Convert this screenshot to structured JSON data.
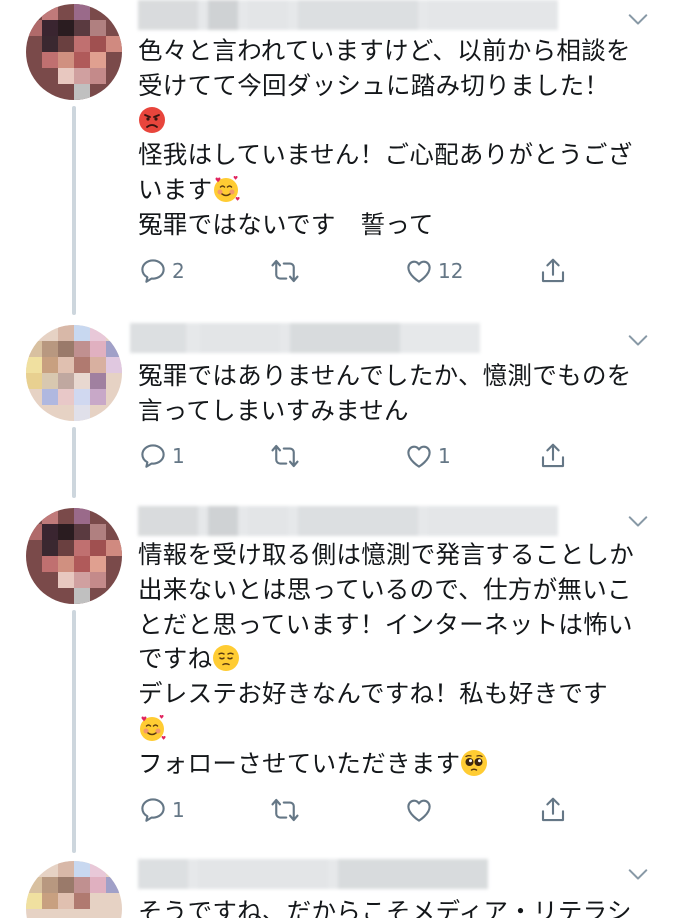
{
  "tweets": [
    {
      "id": "t1",
      "text": "色々と言われていますけど、以前から相談を\n受けてて今回ダッシュに踏み切りました！\n{angry}\n怪我はしていません！ご心配ありがとうござ\nいます{hearts}\n冤罪ではないです　誓って",
      "reply_count": "2",
      "retweet_count": "",
      "like_count": "12"
    },
    {
      "id": "t2",
      "text": "冤罪ではありませんでしたか、憶測でものを\n言ってしまいすみません",
      "reply_count": "1",
      "retweet_count": "",
      "like_count": "1"
    },
    {
      "id": "t3",
      "text": "情報を受け取る側は憶測で発言することしか\n出来ないとは思っているので、仕方が無いこ\nとだと思っています！インターネットは怖い\nですね{pensive}\nデレステお好きなんですね！私も好きです\n{hearts}\nフォローさせていただきます{pleading}",
      "reply_count": "1",
      "retweet_count": "",
      "like_count": ""
    },
    {
      "id": "t4",
      "text": "そうですね、だからこそメディア・リテラシ"
    }
  ],
  "icons": {
    "reply": "reply-icon",
    "retweet": "retweet-icon",
    "like": "heart-icon",
    "share": "share-icon",
    "menu": "chevron-down-icon"
  },
  "colors": {
    "icon_gray": "#657786",
    "thread_line": "#cdd6dd",
    "text": "#14171a"
  }
}
